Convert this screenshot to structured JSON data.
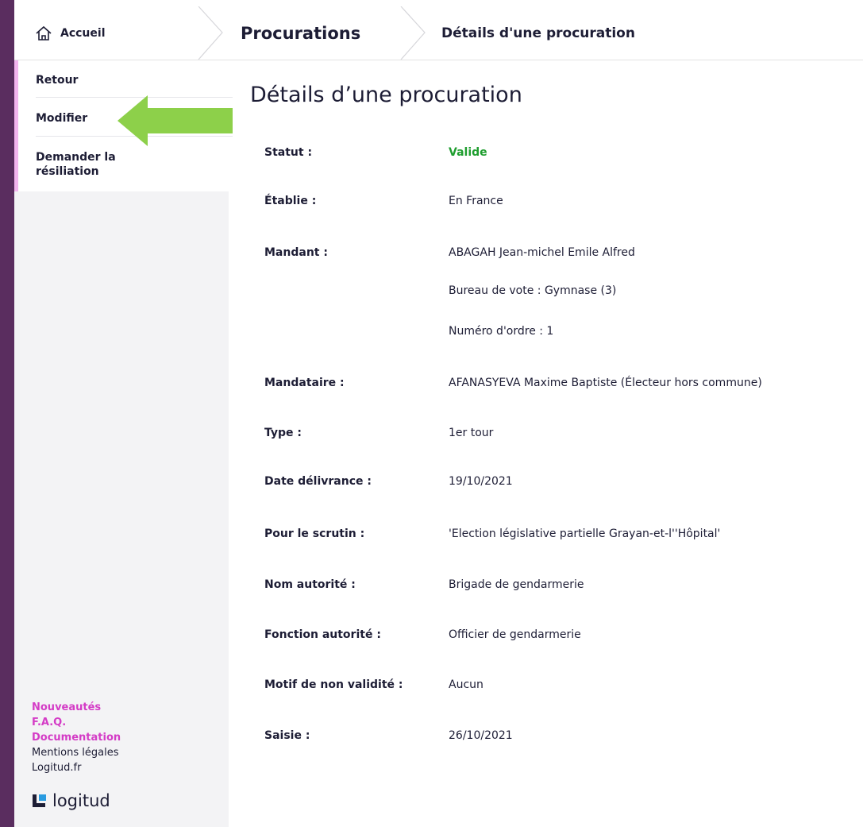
{
  "breadcrumb": {
    "home": "Accueil",
    "section": "Procurations",
    "current": "Détails d'une procuration"
  },
  "sidebar": {
    "items": [
      {
        "label": "Retour"
      },
      {
        "label": "Modifier"
      },
      {
        "label": "Demander la résiliation"
      }
    ],
    "links": [
      {
        "label": "Nouveautés"
      },
      {
        "label": "F.A.Q."
      },
      {
        "label": "Documentation"
      },
      {
        "label": "Mentions légales"
      },
      {
        "label": "Logitud.fr"
      }
    ],
    "logo_text": "logitud"
  },
  "main": {
    "title": "Détails d’une procuration",
    "fields": [
      {
        "label": "Statut :",
        "value": "Valide"
      },
      {
        "label": "Établie :",
        "value": "En France"
      },
      {
        "label": "Mandant :",
        "value": "ABAGAH Jean-michel Emile Alfred",
        "extra": [
          "Bureau de vote : Gymnase (3)",
          "Numéro d'ordre : 1"
        ]
      },
      {
        "label": "Mandataire :",
        "value": "AFANASYEVA Maxime Baptiste (Électeur hors commune)"
      },
      {
        "label": "Type :",
        "value": "1er tour"
      },
      {
        "label": "Date délivrance :",
        "value": "19/10/2021"
      },
      {
        "label": "Pour le scrutin :",
        "value": "'Election législative partielle Grayan-et-l''Hôpital'"
      },
      {
        "label": "Nom autorité :",
        "value": "Brigade de gendarmerie"
      },
      {
        "label": "Fonction autorité :",
        "value": "Officier de gendarmerie"
      },
      {
        "label": "Motif de non validité :",
        "value": "Aucun"
      },
      {
        "label": "Saisie :",
        "value": "26/10/2021"
      }
    ]
  },
  "colors": {
    "frame_bg": "#5a2d5f",
    "valid": "#1f9e2f",
    "accent_pink": "#d43cc6",
    "arrow": "#8dd04a"
  }
}
